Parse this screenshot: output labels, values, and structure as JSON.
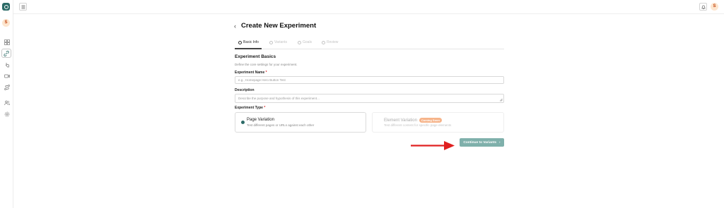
{
  "user": {
    "initial": "S"
  },
  "header": {
    "back_icon": "chevron-left-icon",
    "title": "Create New Experiment"
  },
  "steps": [
    {
      "label": "Basic Info",
      "active": true
    },
    {
      "label": "Variants",
      "active": false
    },
    {
      "label": "Goals",
      "active": false
    },
    {
      "label": "Review",
      "active": false
    }
  ],
  "section": {
    "title": "Experiment Basics",
    "description": "Define the core settings for your experiment."
  },
  "form": {
    "name_label": "Experiment Name",
    "name_placeholder": "e.g., Homepage Hero Button Test",
    "description_label": "Description",
    "description_placeholder": "Describe the purpose and hypothesis of this experiment...",
    "type_label": "Experiment Type",
    "required_mark": "*"
  },
  "types": [
    {
      "title": "Page Variation",
      "description": "Test different pages or URLs against each other",
      "selected": true,
      "badge": ""
    },
    {
      "title": "Element Variation",
      "description": "Test different content for specific page elements",
      "selected": false,
      "badge": "Coming Soon"
    }
  ],
  "actions": {
    "continue_label": "Continue to Variants",
    "continue_icon": "chevron-right-icon"
  },
  "colors": {
    "brand": "#2c6b67",
    "button": "#7fb0ab",
    "badge": "#f6b48a",
    "annotation_arrow": "#e02020"
  }
}
